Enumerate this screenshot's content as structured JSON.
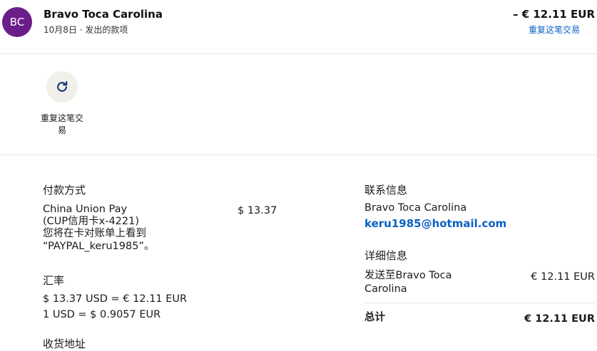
{
  "header": {
    "avatar_initials": "BC",
    "avatar_color": "#6b1e8a",
    "name": "Bravo Toca Carolina",
    "date": "10月8日",
    "separator": " · ",
    "type": "发出的款项",
    "amount": "– € 12.11 EUR",
    "repeat_link": "重复这笔交易"
  },
  "actions": {
    "repeat_icon": "refresh-icon",
    "repeat_label": "重复这笔交易"
  },
  "payment": {
    "title": "付款方式",
    "method_line1": "China Union Pay",
    "method_line2": "(CUP信用卡x-4221)",
    "method_line3": "您将在卡对账单上看到",
    "method_line4": "“PAYPAL_keru1985”。",
    "amount": "$ 13.37"
  },
  "exchange": {
    "title": "汇率",
    "line1": "$ 13.37 USD = € 12.11 EUR",
    "line2": "1 USD = $ 0.9057 EUR",
    "next_title": "收货地址"
  },
  "contact": {
    "title": "联系信息",
    "name": "Bravo Toca Carolina",
    "email": "keru1985@hotmail.com"
  },
  "details": {
    "title": "详细信息",
    "sent_to_line1": "发送至Bravo Toca",
    "sent_to_line2": "Carolina",
    "sent_amount": "€ 12.11 EUR",
    "total_label": "总计",
    "total_amount": "€ 12.11 EUR"
  },
  "colors": {
    "link": "#0b61c4",
    "divider": "#e6e6e6",
    "action_bg": "#f1efe9",
    "icon": "#0b2a7a"
  }
}
